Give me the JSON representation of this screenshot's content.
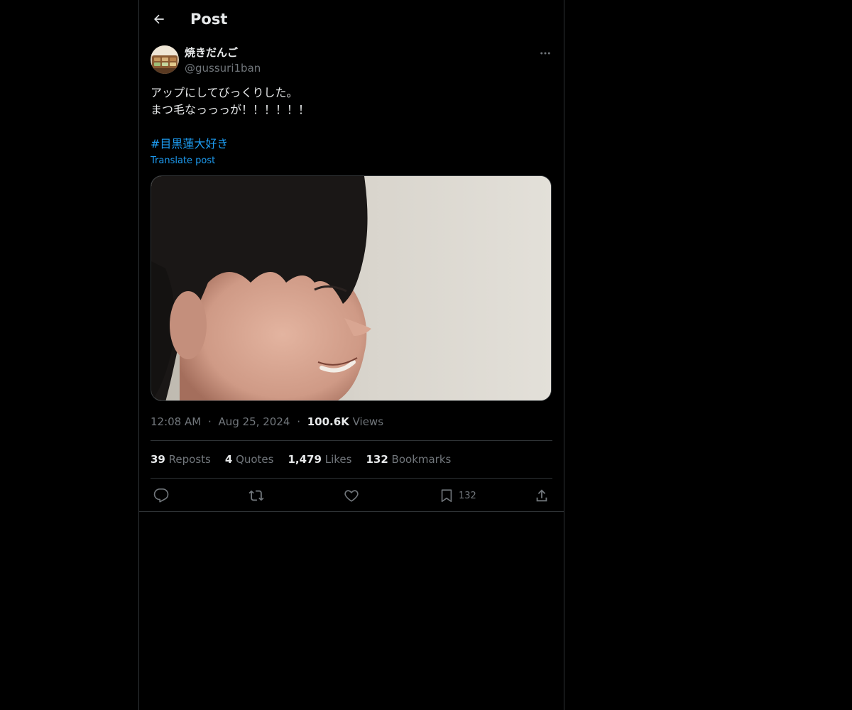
{
  "header": {
    "title": "Post",
    "back_icon": "arrow-left-icon"
  },
  "author": {
    "display_name": "焼きだんご",
    "handle": "@gussuri1ban"
  },
  "post": {
    "lines": [
      "アップにしてびっくりした。",
      "まつ毛なっっっが！！！！！！"
    ],
    "hashtag": "#目黒蓮大好き",
    "translate_label": "Translate post"
  },
  "meta": {
    "time": "12:08 AM",
    "separator": "·",
    "date": "Aug 25, 2024",
    "views_count": "100.6K",
    "views_label": "Views"
  },
  "stats": {
    "reposts_count": "39",
    "reposts_label": "Reposts",
    "quotes_count": "4",
    "quotes_label": "Quotes",
    "likes_count": "1,479",
    "likes_label": "Likes",
    "bookmarks_count": "132",
    "bookmarks_label": "Bookmarks"
  },
  "actions": {
    "bookmark_count": "132"
  },
  "colors": {
    "background": "#000000",
    "text": "#e7e9ea",
    "secondary": "#71767b",
    "accent": "#1d9bf0",
    "border": "#2f3336"
  }
}
